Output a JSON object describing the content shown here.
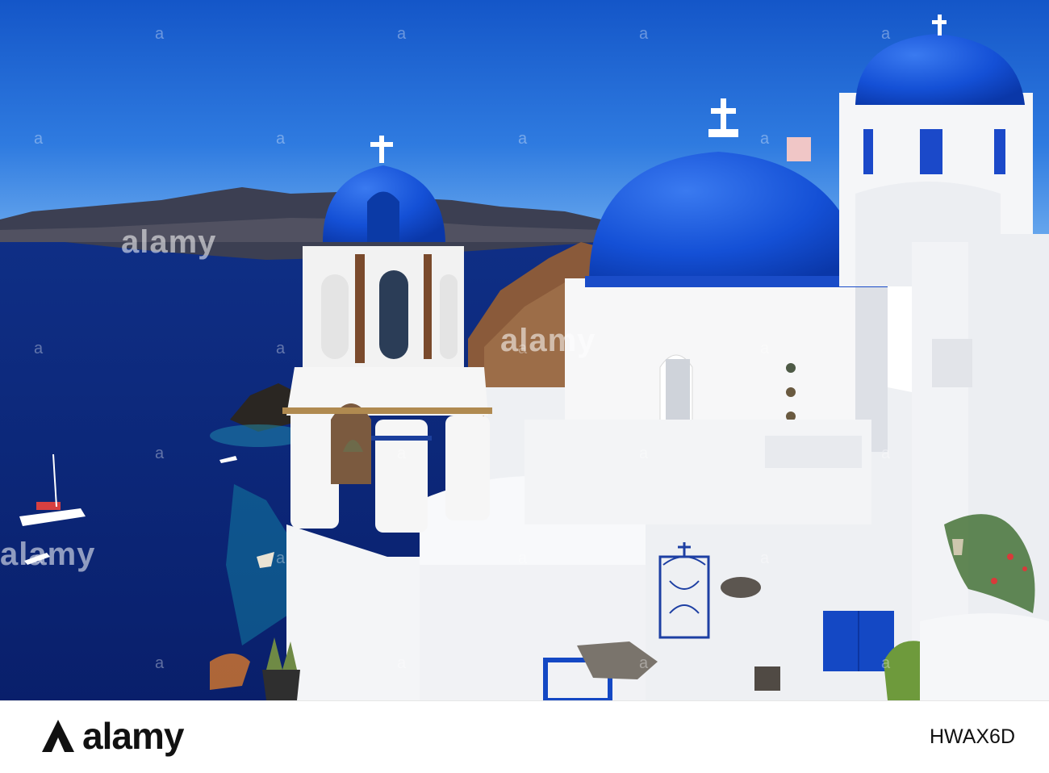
{
  "photo": {
    "subject": "santorini-blue-domed-churches",
    "colors": {
      "sky": "#1e66d6",
      "sea": "#0d2f8c",
      "dome": "#1454d9",
      "wall": "#f4f5f7"
    }
  },
  "watermark": {
    "text": "alamy"
  },
  "footer": {
    "brand": "alamy",
    "image_id": "HWAX6D"
  }
}
